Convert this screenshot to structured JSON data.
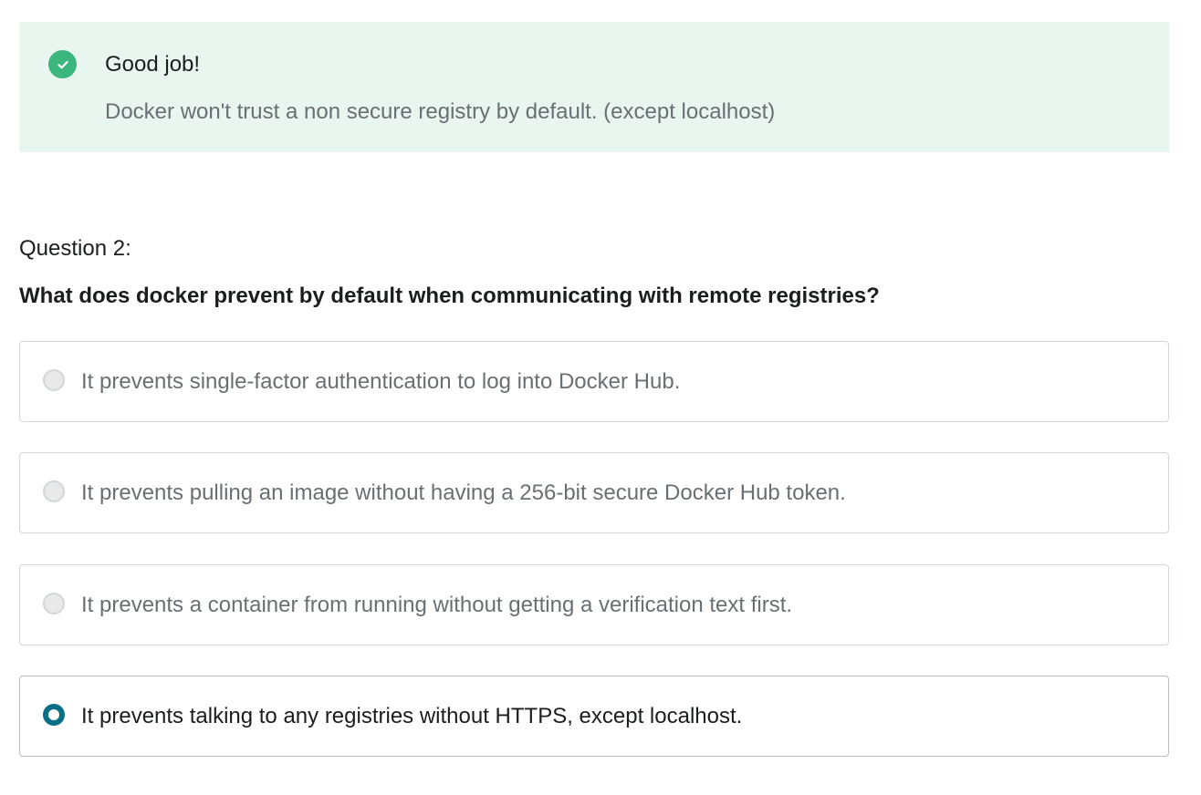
{
  "feedback": {
    "icon": "check-circle-icon",
    "title": "Good job!",
    "message": "Docker won't trust a non secure registry by default. (except localhost)",
    "accent_color": "#3bb77e",
    "background_color": "#e8f6ef"
  },
  "question": {
    "label": "Question 2:",
    "prompt": "What does docker prevent by default when communicating with remote registries?"
  },
  "options": [
    {
      "text": "It prevents single-factor authentication to log into Docker Hub.",
      "selected": false
    },
    {
      "text": "It prevents pulling an image without having a 256-bit secure Docker Hub token.",
      "selected": false
    },
    {
      "text": "It prevents a container from running without getting a verification text first.",
      "selected": false
    },
    {
      "text": "It prevents talking to any registries without HTTPS, except localhost.",
      "selected": true
    }
  ],
  "colors": {
    "selected_radio": "#0a6f86"
  }
}
